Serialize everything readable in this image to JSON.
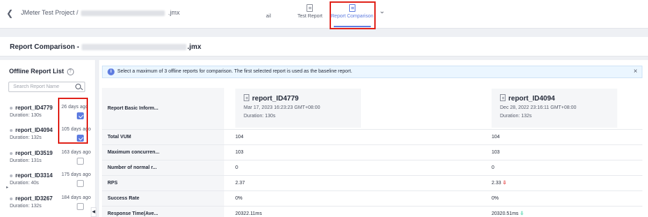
{
  "header": {
    "breadcrumb_prefix": "JMeter Test Project /",
    "breadcrumb_suffix": ".jmx",
    "tabs": [
      {
        "label": "ail"
      },
      {
        "label": "Test Report"
      },
      {
        "label": "Report Comparison",
        "active": true
      }
    ]
  },
  "title": {
    "prefix": "Report Comparison -",
    "suffix": ".jmx"
  },
  "sidebar": {
    "heading": "Offline Report List",
    "search_placeholder": "Search Report Name",
    "items": [
      {
        "name": "report_ID4779",
        "age": "26 days ago",
        "duration": "Duration: 130s",
        "checked": true
      },
      {
        "name": "report_ID4094",
        "age": "105 days ago",
        "duration": "Duration: 132s",
        "checked": true
      },
      {
        "name": "report_ID3519",
        "age": "163 days ago",
        "duration": "Duration: 131s",
        "checked": false
      },
      {
        "name": "report_ID3314",
        "age": "175 days ago",
        "duration": "Duration: 40s",
        "checked": false
      },
      {
        "name": "report_ID3267",
        "age": "184 days ago",
        "duration": "Duration: 132s",
        "checked": false
      }
    ]
  },
  "alert": {
    "message": "Select a maximum of 3 offline reports for comparison. The first selected report is used as the baseline report."
  },
  "comparison": {
    "basic_label": "Report Basic Inform...",
    "reports": [
      {
        "name": "report_ID4779",
        "date": "Mar 17, 2023 16:23:23 GMT+08:00",
        "duration": "Duration: 130s"
      },
      {
        "name": "report_ID4094",
        "date": "Dec 28, 2022 23:16:11 GMT+08:00",
        "duration": "Duration: 132s"
      }
    ],
    "rows": [
      {
        "label": "Total VUM",
        "v1": "104",
        "v2": "104",
        "trend": ""
      },
      {
        "label": "Maximum concurren...",
        "v1": "103",
        "v2": "103",
        "trend": ""
      },
      {
        "label": "Number of normal r...",
        "v1": "0",
        "v2": "0",
        "trend": ""
      },
      {
        "label": "RPS",
        "v1": "2.37",
        "v2": "2.33",
        "trend": "down"
      },
      {
        "label": "Success Rate",
        "v1": "0%",
        "v2": "0%",
        "trend": ""
      },
      {
        "label": "Response Time(Ave...",
        "v1": "20322.11ms",
        "v2": "20320.51ms",
        "trend": "up"
      }
    ]
  },
  "colors": {
    "accent": "#5e7ce0",
    "highlight": "#e0221a",
    "down": "#e54545",
    "up": "#50d4ab"
  }
}
